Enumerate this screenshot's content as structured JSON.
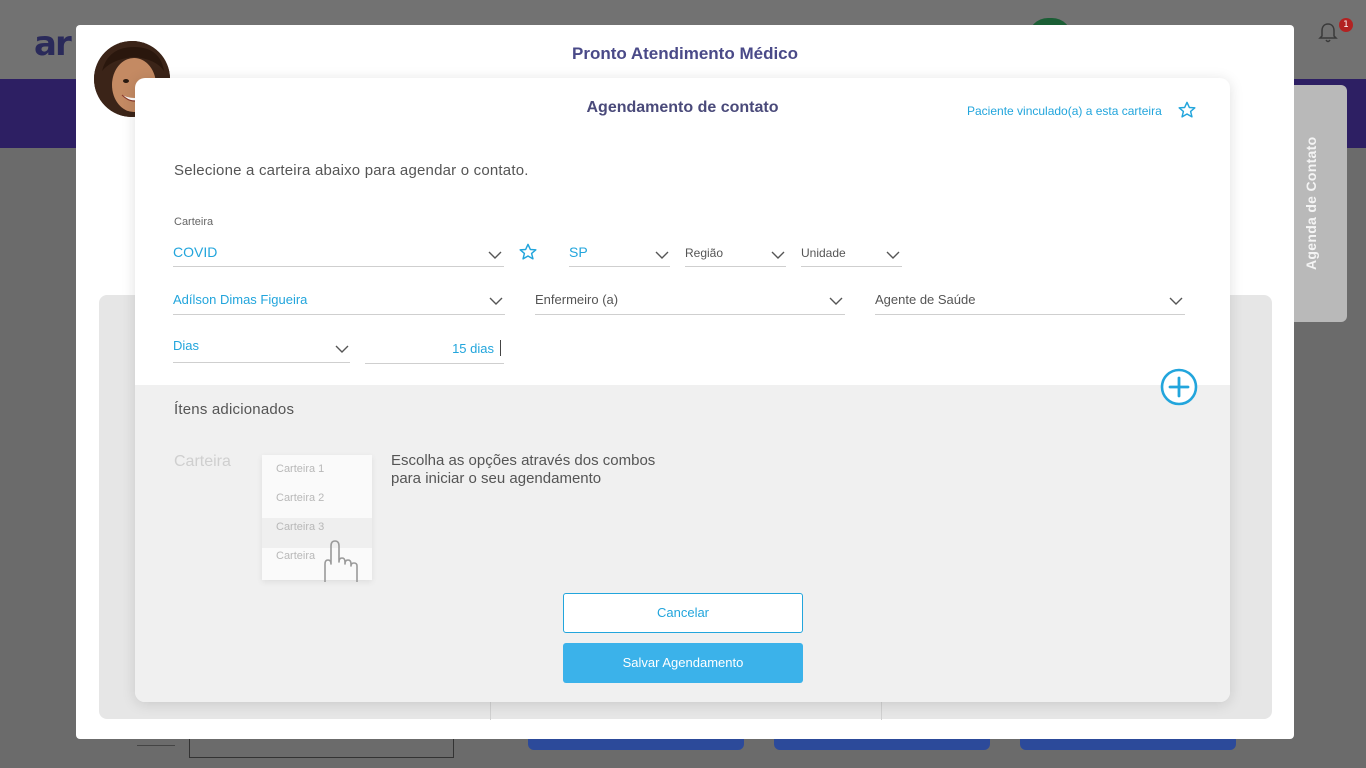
{
  "background": {
    "logo_text": "ar",
    "notification_count": "1"
  },
  "side_tab": {
    "label": "Agenda de Contato"
  },
  "outer_modal": {
    "title": "Pronto Atendimento Médico"
  },
  "inner_modal": {
    "title": "Agendamento de contato",
    "linked_text": "Paciente vinculado(a) a esta carteira",
    "instruction": "Selecione a carteira abaixo para agendar o contato."
  },
  "form": {
    "carteira": {
      "label": "Carteira",
      "value": "COVID"
    },
    "estado": {
      "value": "SP"
    },
    "regiao": {
      "placeholder": "Região"
    },
    "unidade": {
      "placeholder": "Unidade"
    },
    "profissional": {
      "value": "Adílson Dimas Figueira"
    },
    "enfermeiro": {
      "placeholder": "Enfermeiro (a)"
    },
    "agente": {
      "placeholder": "Agente de Saúde"
    },
    "periodo": {
      "value": "Dias"
    },
    "quantidade": {
      "value": "15 dias"
    }
  },
  "added": {
    "title": "Ítens adicionados",
    "ghost_label": "Carteira",
    "ghost_items": [
      "Carteira 1",
      "Carteira 2",
      "Carteira 3",
      "Carteira"
    ],
    "hint_line1": "Escolha as opções através dos combos",
    "hint_line2": "para iniciar o seu agendamento"
  },
  "buttons": {
    "cancel": "Cancelar",
    "save": "Salvar Agendamento"
  },
  "colors": {
    "accent": "#22a5dc",
    "primary_button": "#3bb2ea",
    "title": "#4a4a88"
  }
}
